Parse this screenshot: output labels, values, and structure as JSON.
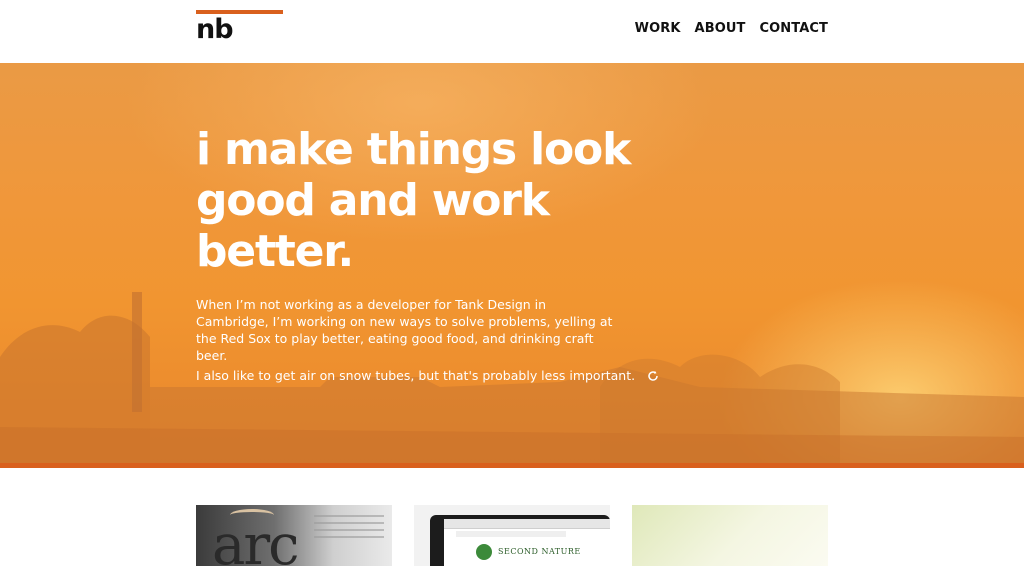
{
  "header": {
    "logo_text": "nb",
    "nav": [
      {
        "label": "WORK"
      },
      {
        "label": "ABOUT"
      },
      {
        "label": "CONTACT"
      }
    ]
  },
  "hero": {
    "headline_lines": [
      "i make things look",
      "good and work",
      "better."
    ],
    "paragraph_1": "When I’m not working as a developer for Tank Design in Cambridge, I’m working on new ways to solve problems, yelling at the Red Sox to play better, eating good food, and drinking craft beer.",
    "paragraph_2": "I also like to get air on snow tubes, but that's probably less important.",
    "refresh_icon": "refresh-icon"
  },
  "cards": {
    "card_1": {
      "label": "arc"
    },
    "card_2": {
      "label": "SECOND NATURE"
    }
  },
  "colors": {
    "accent": "#d9601d",
    "hero_orange": "#f0973a",
    "text_dark": "#111111",
    "text_light": "#ffffff"
  }
}
